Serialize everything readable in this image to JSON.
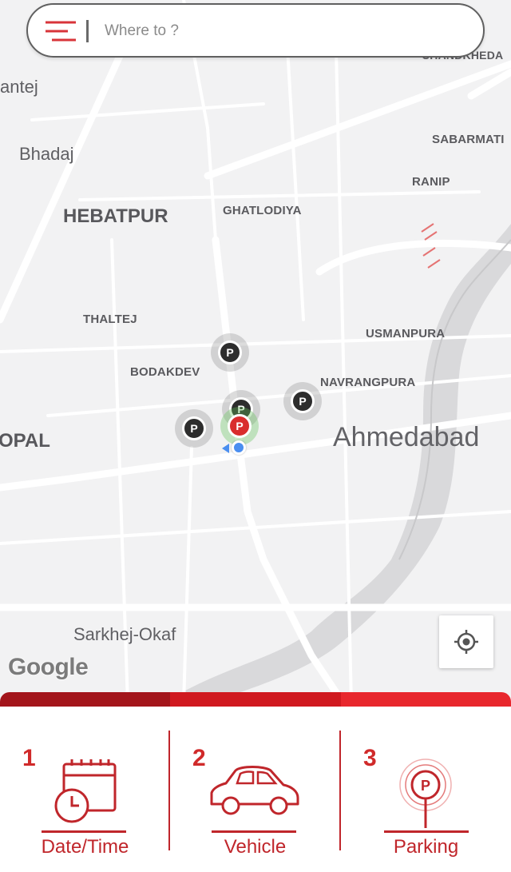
{
  "search": {
    "placeholder": "Where to ?"
  },
  "map": {
    "places": [
      {
        "id": "chandkheda",
        "label": "CHANDKHEDA"
      },
      {
        "id": "santej",
        "label": "antej"
      },
      {
        "id": "bhadaj",
        "label": "Bhadaj"
      },
      {
        "id": "sabarmati",
        "label": "SABARMATI"
      },
      {
        "id": "ranip",
        "label": "RANIP"
      },
      {
        "id": "hebatpur",
        "label": "HEBATPUR"
      },
      {
        "id": "ghatlodiya",
        "label": "GHATLODIYA"
      },
      {
        "id": "thaltej",
        "label": "THALTEJ"
      },
      {
        "id": "usmanpura",
        "label": "USMANPURA"
      },
      {
        "id": "bodakdev",
        "label": "BODAKDEV"
      },
      {
        "id": "navrangpura",
        "label": "NAVRANGPURA"
      },
      {
        "id": "bopal",
        "label": "OPAL"
      },
      {
        "id": "ahmedabad",
        "label": "Ahmedabad"
      },
      {
        "id": "sarkhej",
        "label": "Sarkhej-Okaf"
      }
    ],
    "pin_label": "P",
    "attribution": "Google"
  },
  "progress": {
    "colors": [
      "#a3151b",
      "#d0191f",
      "#e8272d"
    ]
  },
  "steps": [
    {
      "number": "1",
      "label": "Date/Time",
      "icon": "calendar-clock-icon"
    },
    {
      "number": "2",
      "label": "Vehicle",
      "icon": "car-icon"
    },
    {
      "number": "3",
      "label": "Parking",
      "icon": "parking-pin-icon"
    }
  ],
  "colors": {
    "accent": "#c0262b",
    "pin_dark": "#2d2d2d",
    "pin_active": "#d92d2d",
    "location": "#4a8ef0"
  }
}
